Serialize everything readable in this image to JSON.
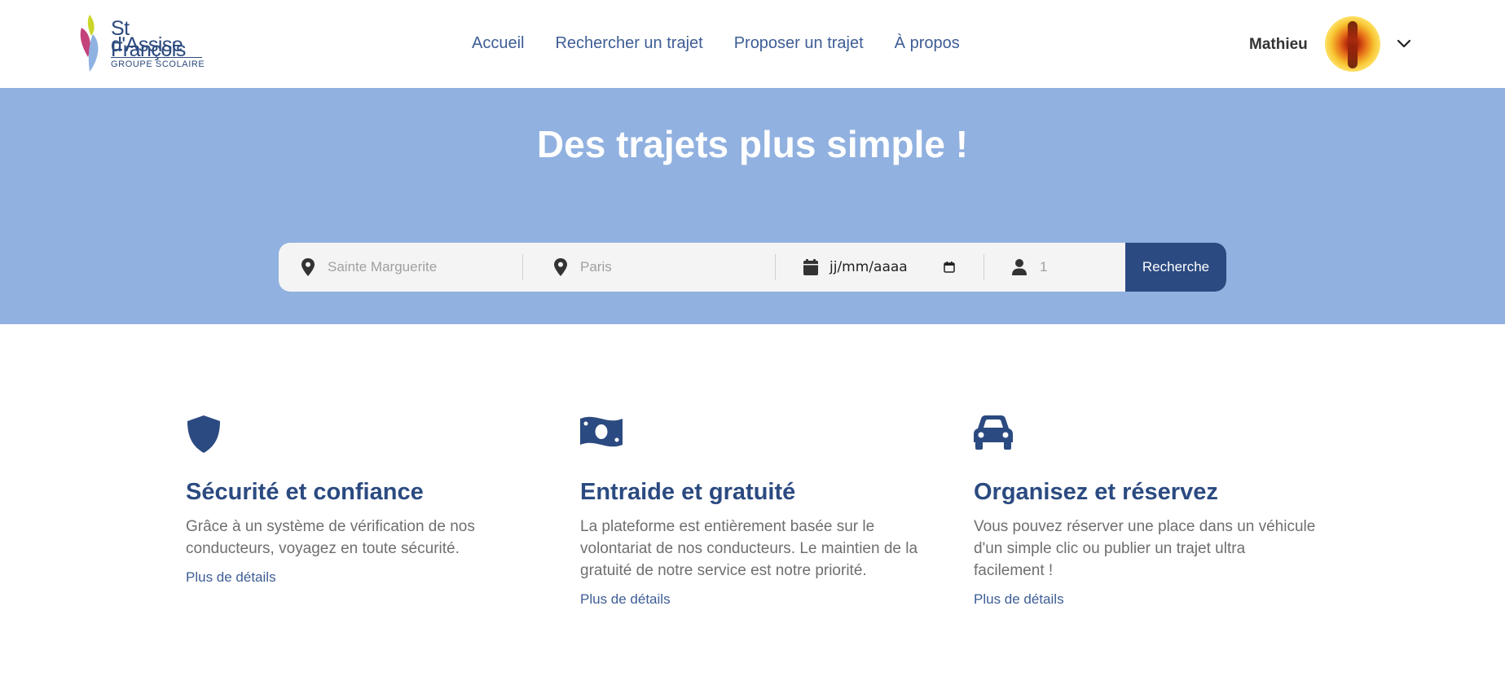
{
  "logo": {
    "line1": "St François",
    "line2": "d'Assise",
    "line3": "GROUPE SCOLAIRE"
  },
  "nav": {
    "items": [
      "Accueil",
      "Rechercher un trajet",
      "Proposer un trajet",
      "À propos"
    ]
  },
  "user": {
    "name": "Mathieu"
  },
  "hero": {
    "title": "Des trajets plus simple !"
  },
  "search": {
    "departure_placeholder": "Sainte Marguerite",
    "destination_placeholder": "Paris",
    "date_placeholder": "jj/mm/aaaa",
    "passengers_placeholder": "1",
    "button_label": "Recherche"
  },
  "features": [
    {
      "icon": "shield-icon",
      "title": "Sécurité et confiance",
      "text": "Grâce à un système de vérification de nos conducteurs, voyagez en toute sécurité.",
      "link": "Plus de détails"
    },
    {
      "icon": "money-bill-icon",
      "title": "Entraide et gratuité",
      "text": "La plateforme est entièrement basée sur le volontariat de nos conducteurs. Le maintien de la gratuité de notre service est notre priorité.",
      "link": "Plus de détails"
    },
    {
      "icon": "car-icon",
      "title": "Organisez et réservez",
      "text": "Vous pouvez réserver une place dans un véhicule d'un simple clic ou publier un trajet ultra facilement !",
      "link": "Plus de détails"
    }
  ],
  "colors": {
    "primary": "#2b4a81",
    "hero_bg": "#91b1e0",
    "nav_link": "#3d5d95",
    "search_bg": "#f4f4f4"
  }
}
